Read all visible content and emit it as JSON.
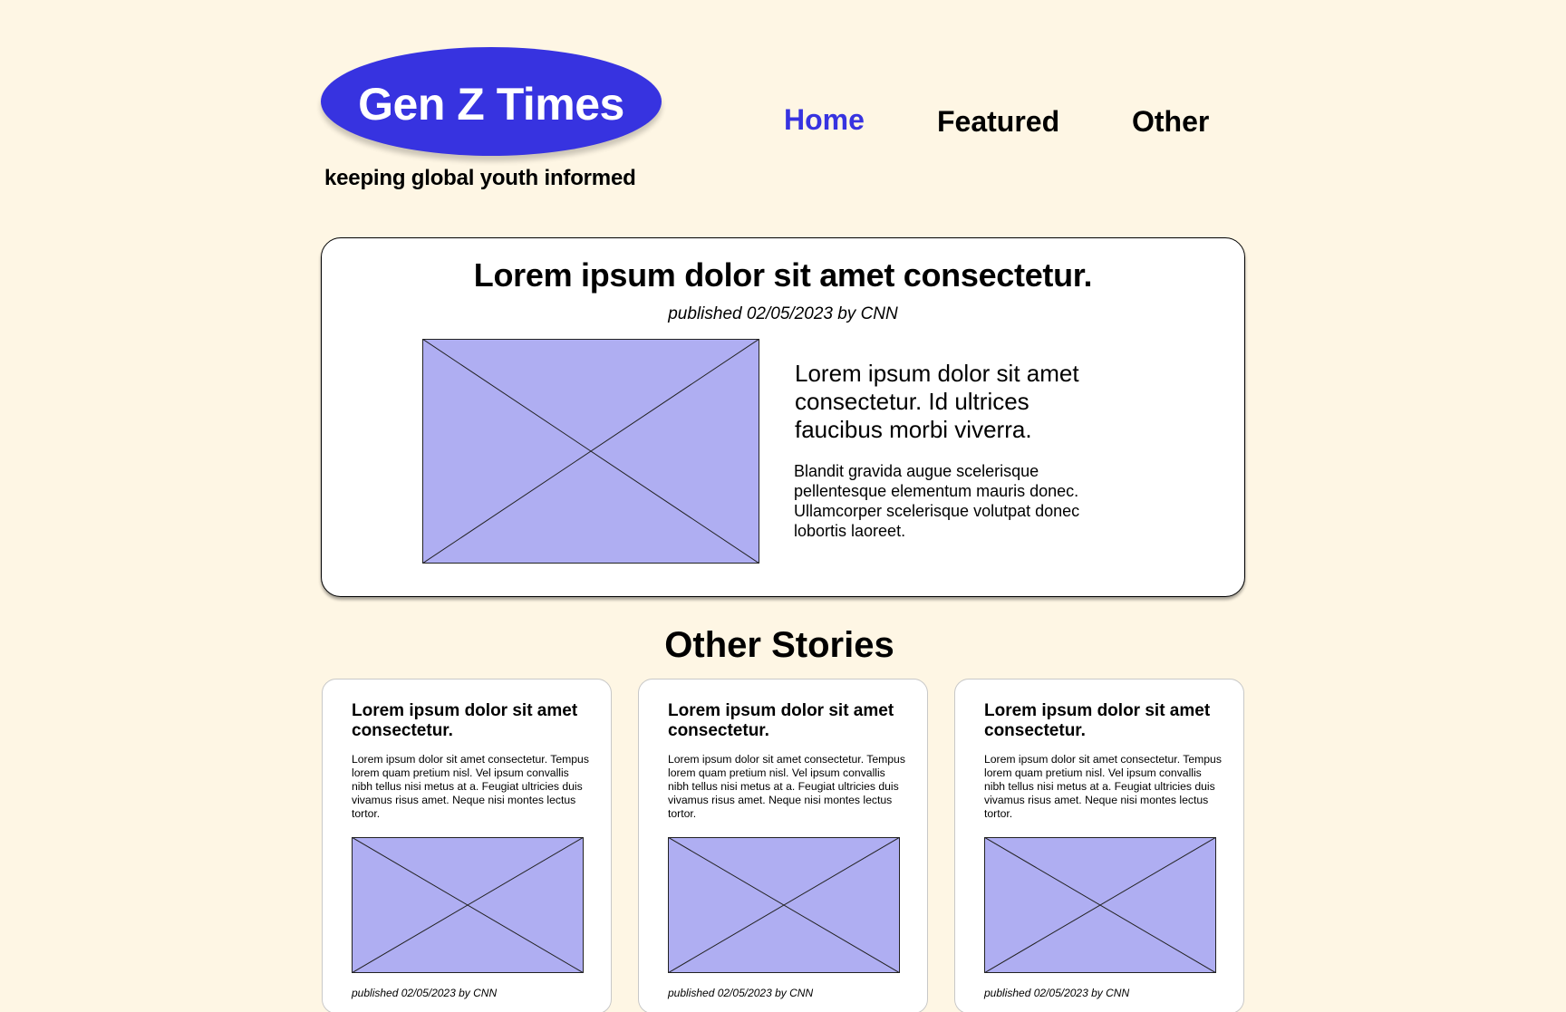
{
  "header": {
    "logo_text": "Gen Z Times",
    "tagline": "keeping global youth informed",
    "nav": {
      "home": "Home",
      "featured": "Featured",
      "other": "Other"
    }
  },
  "main_story": {
    "title": "Lorem ipsum dolor sit amet consectetur.",
    "byline": "published 02/05/2023 by CNN",
    "lead": "Lorem ipsum dolor sit amet consectetur. Id ultrices faucibus morbi viverra.",
    "body": "Blandit gravida augue scelerisque pellentesque elementum mauris donec. Ullamcorper scelerisque volutpat donec lobortis laoreet."
  },
  "other_stories": {
    "heading": "Other Stories",
    "items": [
      {
        "title": "Lorem ipsum dolor sit amet consectetur.",
        "body": "Lorem ipsum dolor sit amet consectetur. Tempus lorem quam pretium nisl. Vel ipsum convallis nibh tellus nisi metus at a. Feugiat ultricies duis vivamus risus amet. Neque nisi montes lectus tortor.",
        "byline": "published 02/05/2023 by CNN"
      },
      {
        "title": "Lorem ipsum dolor sit amet consectetur.",
        "body": "Lorem ipsum dolor sit amet consectetur. Tempus lorem quam pretium nisl. Vel ipsum convallis nibh tellus nisi metus at a. Feugiat ultricies duis vivamus risus amet. Neque nisi montes lectus tortor.",
        "byline": "published 02/05/2023 by CNN"
      },
      {
        "title": "Lorem ipsum dolor sit amet consectetur.",
        "body": "Lorem ipsum dolor sit amet consectetur. Tempus lorem quam pretium nisl. Vel ipsum convallis nibh tellus nisi metus at a. Feugiat ultricies duis vivamus risus amet. Neque nisi montes lectus tortor.",
        "byline": "published 02/05/2023 by CNN"
      }
    ]
  },
  "colors": {
    "background": "#fef6e4",
    "brand": "#3733e0",
    "placeholder": "#afaef2"
  }
}
